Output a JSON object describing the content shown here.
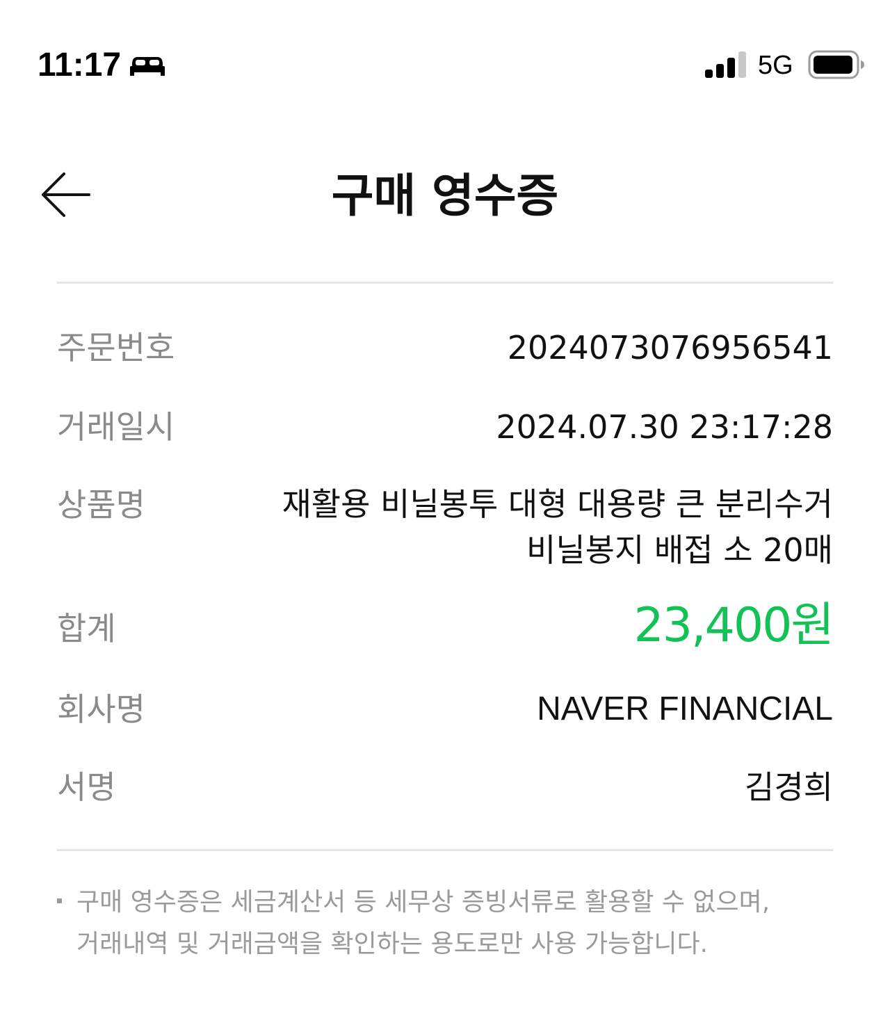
{
  "status_bar": {
    "time": "11:17",
    "focus_icon": "sleep-bed-icon",
    "signal_icon": "cellular-signal-icon",
    "network": "5G",
    "battery_icon": "battery-icon"
  },
  "header": {
    "back_icon": "arrow-left-icon",
    "title": "구매 영수증"
  },
  "receipt": {
    "order_number": {
      "label": "주문번호",
      "value": "2024073076956541"
    },
    "transaction_datetime": {
      "label": "거래일시",
      "value": "2024.07.30 23:17:28"
    },
    "product_name": {
      "label": "상품명",
      "value": "재활용 비닐봉투 대형 대용량 큰 분리수거 비닐봉지 배접 소 20매"
    },
    "total": {
      "label": "합계",
      "value": "23,400원"
    },
    "company_name": {
      "label": "회사명",
      "value": "NAVER FINANCIAL"
    },
    "signature": {
      "label": "서명",
      "value": "김경희"
    }
  },
  "notice": {
    "text": "구매 영수증은 세금계산서 등 세무상 증빙서류로 활용할 수 없으며, 거래내역 및 거래금액을 확인하는 용도로만 사용 가능합니다."
  },
  "colors": {
    "accent_green": "#12c257",
    "label_gray": "#8a8a8a",
    "divider": "#e6e6e6"
  }
}
